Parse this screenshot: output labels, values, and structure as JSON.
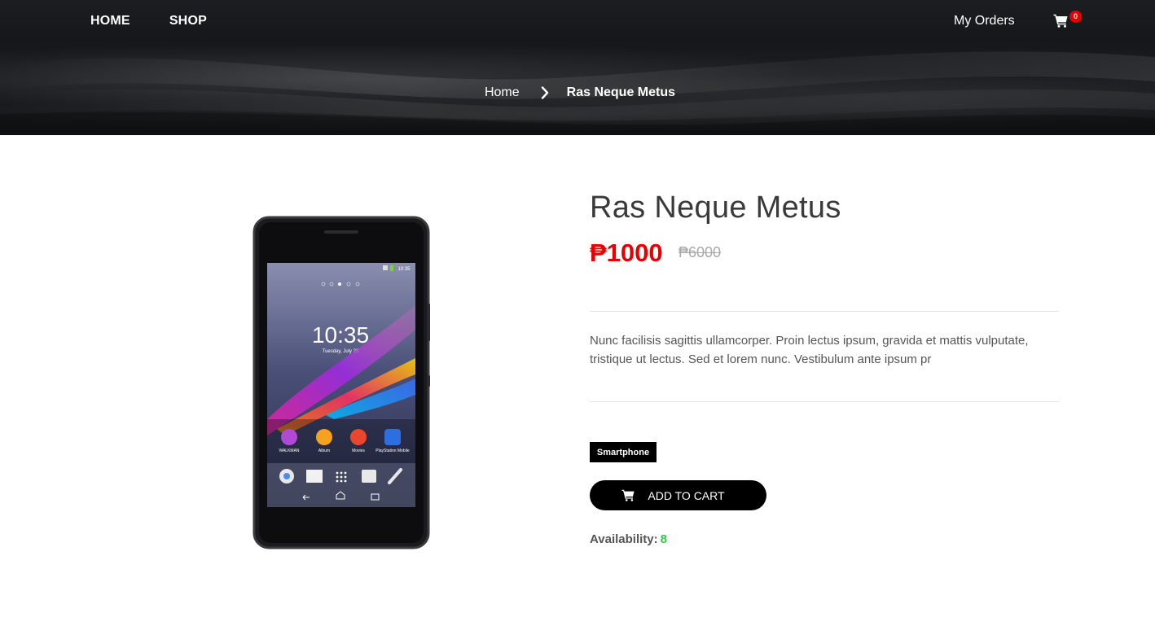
{
  "nav": {
    "home_label": "HOME",
    "shop_label": "SHOP",
    "orders_label": "My Orders",
    "cart_icon": "shopping-cart-icon",
    "cart_count": "0"
  },
  "breadcrumb": {
    "home_label": "Home",
    "separator_icon": "chevron-right-icon",
    "current_label": "Ras Neque Metus"
  },
  "product": {
    "title": "Ras Neque Metus",
    "price_current": "₱1000",
    "price_original": "₱6000",
    "description": "Nunc facilisis sagittis ullamcorper. Proin lectus ipsum, gravida et mattis vulputate, tristique ut lectus. Sed et lorem nunc. Vestibulum ante ipsum pr",
    "tag": "Smartphone",
    "add_to_cart_label": "ADD TO CART",
    "add_to_cart_icon": "shopping-cart-icon",
    "availability_label": "Availability:",
    "availability_count": "8",
    "image": {
      "alt": "smartphone",
      "screen_time": "10:35",
      "screen_date": "Tuesday, July 23",
      "status_time": "10:35",
      "apps": [
        "WALKMAN",
        "Album",
        "Movies",
        "PlayStation Mobile"
      ]
    }
  },
  "colors": {
    "accent_price": "#e60000",
    "availability": "#2ecc40",
    "header_bg": "#1a1b1e",
    "button_bg": "#000000"
  }
}
